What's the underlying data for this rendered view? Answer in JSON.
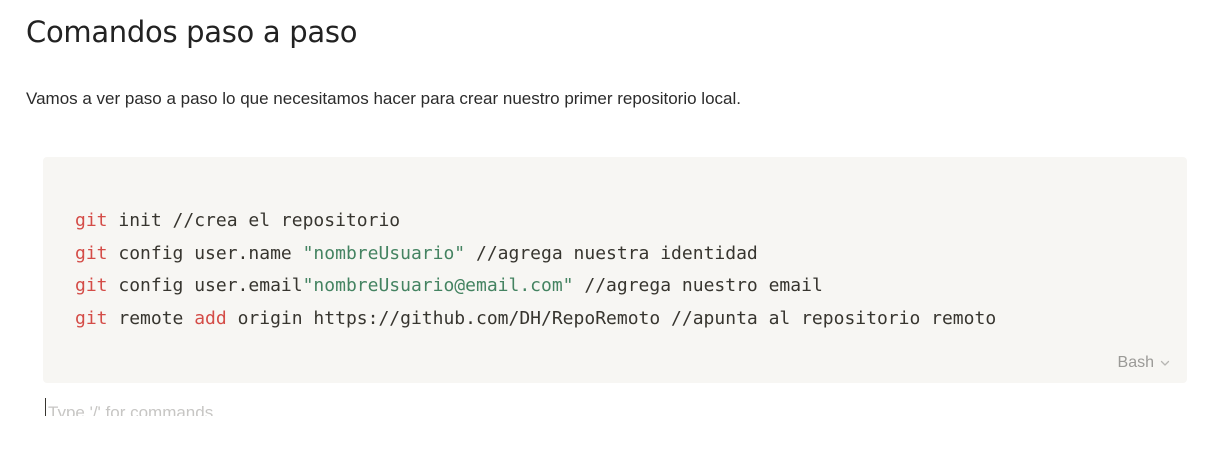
{
  "heading": "Comandos paso a paso",
  "intro": "Vamos a ver paso a paso lo que necesitamos hacer para crear nuestro primer repositorio local.",
  "code": {
    "language": "Bash",
    "lines": [
      {
        "cmd": "git",
        "rest": " init //crea el repositorio"
      },
      {
        "cmd": "git",
        "a": " config user.name ",
        "str": "\"nombreUsuario\"",
        "b": " //agrega nuestra identidad"
      },
      {
        "cmd": "git",
        "a": " config user.email",
        "str": "\"nombreUsuario@email.com\"",
        "b": " //agrega nuestro email"
      },
      {
        "cmd": "git",
        "a": " remote ",
        "kw": "add",
        "b": " origin https://github.com/DH/RepoRemoto //apunta al repositorio remoto"
      }
    ]
  },
  "editor": {
    "placeholder": "Type '/' for commands"
  },
  "colors": {
    "keyword": "#d44c47",
    "string": "#448361",
    "code_background": "#f7f6f3"
  },
  "icons": {
    "language_dropdown": "chevron-down-icon"
  }
}
